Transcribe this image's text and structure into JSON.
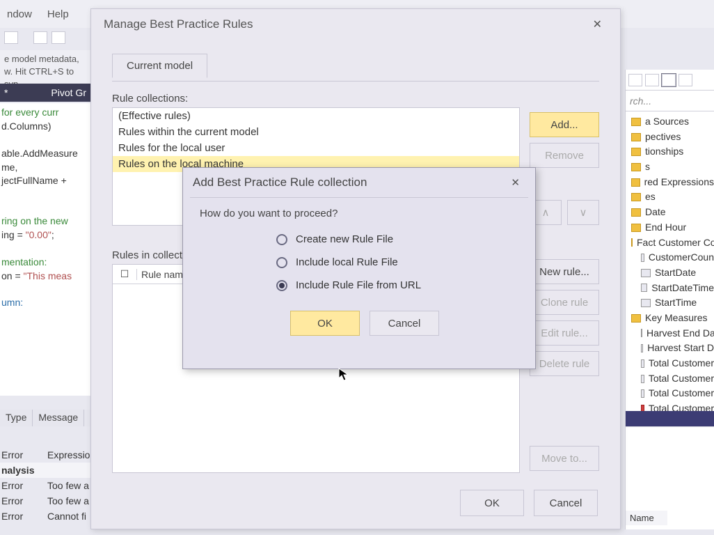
{
  "menu": {
    "window": "ndow",
    "help": "Help"
  },
  "hint": "e model metadata, w. Hit CTRL+S to syn",
  "doc_tab": {
    "name": "*",
    "pivot": "Pivot Gr"
  },
  "code_lines": {
    "l1a": "for every curr",
    "l1b": "d.Columns)",
    "l2a": "able.AddMeasure",
    "l2b": "me,",
    "l2c": "jectFullName + ",
    "l3a": "ring on the new",
    "l3b": "ing = ",
    "l3c": "\"0.00\"",
    "l3d": ";",
    "l4a": "mentation:",
    "l4b": "on = ",
    "l4c": "\"This meas",
    "l5a": "umn:"
  },
  "messages": {
    "col1": "Type",
    "col2": "Message",
    "rows": [
      {
        "t": "Error",
        "m": "Expressio"
      }
    ],
    "section": "nalysis",
    "rows2": [
      {
        "t": "Error",
        "m": "Too few a"
      },
      {
        "t": "Error",
        "m": "Too few a"
      },
      {
        "t": "Error",
        "m": "Cannot fi"
      }
    ]
  },
  "tom": {
    "search_ph": "rch...",
    "items": [
      {
        "label": "a Sources",
        "kind": "folder"
      },
      {
        "label": "pectives",
        "kind": "folder"
      },
      {
        "label": "tionships",
        "kind": "folder"
      },
      {
        "label": "s",
        "kind": "folder"
      },
      {
        "label": "red Expressions",
        "kind": "folder"
      },
      {
        "label": "es",
        "kind": "folder"
      },
      {
        "label": "Date",
        "kind": "folder"
      },
      {
        "label": "End Hour",
        "kind": "folder"
      },
      {
        "label": "Fact Customer Cou",
        "kind": "folder"
      },
      {
        "label": "CustomerCoun",
        "kind": "col",
        "ind": 1
      },
      {
        "label": "StartDate",
        "kind": "col",
        "ind": 1
      },
      {
        "label": "StartDateTime",
        "kind": "col",
        "ind": 1
      },
      {
        "label": "StartTime",
        "kind": "col",
        "ind": 1
      },
      {
        "label": "Key Measures",
        "kind": "folder"
      },
      {
        "label": "Harvest End Da",
        "kind": "col",
        "ind": 1
      },
      {
        "label": "Harvest Start D",
        "kind": "col",
        "ind": 1
      },
      {
        "label": "Total Customer",
        "kind": "col",
        "ind": 1
      },
      {
        "label": "Total Customer",
        "kind": "col",
        "ind": 1
      },
      {
        "label": "Total Customer",
        "kind": "col",
        "ind": 1
      },
      {
        "label": "Total Customer",
        "kind": "meas",
        "ind": 1
      }
    ],
    "prop_name": "Name"
  },
  "dlg1": {
    "title": "Manage Best Practice Rules",
    "tab": "Current model",
    "collections_label": "Rule collections:",
    "collections": [
      "(Effective rules)",
      "Rules within the current model",
      "Rules for the local user",
      "Rules on the local machine"
    ],
    "add_btn": "Add...",
    "remove_btn": "Remove",
    "up_btn": "∧",
    "down_btn": "∨",
    "rules_in_label": "Rules in collecti",
    "rules_header": "Rule nam",
    "new_rule": "New rule...",
    "clone_rule": "Clone rule",
    "edit_rule": "Edit rule...",
    "delete_rule": "Delete rule",
    "move_to": "Move to...",
    "ok": "OK",
    "cancel": "Cancel"
  },
  "dlg2": {
    "title": "Add Best Practice Rule collection",
    "question": "How do you want to proceed?",
    "opt1": "Create new Rule File",
    "opt2": "Include local Rule File",
    "opt3": "Include Rule File from URL",
    "selected": 3,
    "ok": "OK",
    "cancel": "Cancel"
  }
}
